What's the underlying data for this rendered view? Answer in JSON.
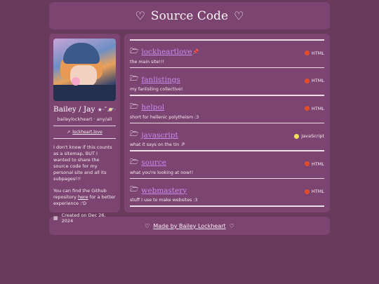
{
  "header": {
    "title": "Source Code",
    "heart_left": "♡",
    "heart_right": "♡"
  },
  "profile": {
    "name": "Bailey / Jay",
    "name_deco": "★‧˚🪐‧",
    "handle": "baileylockheart · any/all",
    "link_text": "lockheart.love",
    "bio_1": "I don't know if this counts as a sitemap, BUT I wanted to share the source code for my personal site and all its subpages!!!",
    "bio_2_before": "You can find the Github repository ",
    "bio_2_link": "here",
    "bio_2_after": " for a better experience :'D",
    "created": "Created on Dec 26, 2024"
  },
  "repos": [
    {
      "name": "lockheartlove",
      "pin": "📌",
      "desc": "the main site!!!",
      "lang": "HTML",
      "lang_color": "#e34c26"
    },
    {
      "name": "fanlistings",
      "pin": "",
      "desc": "my fanlisting collective!",
      "lang": "HTML",
      "lang_color": "#e34c26"
    },
    {
      "name": "helpol",
      "pin": "",
      "desc": "short for hellenic polytheism :3",
      "lang": "HTML",
      "lang_color": "#e34c26"
    },
    {
      "name": "javascript",
      "pin": "",
      "desc": "what it says on the tin :P",
      "lang": "JavaScript",
      "lang_color": "#f1e05a"
    },
    {
      "name": "source",
      "pin": "",
      "desc": "what you're looking at now!!",
      "lang": "HTML",
      "lang_color": "#e34c26"
    },
    {
      "name": "webmastery",
      "pin": "",
      "desc": "stuff I use to make websites :3",
      "lang": "HTML",
      "lang_color": "#e34c26"
    }
  ],
  "footer": {
    "heart_left": "♡",
    "credit": "Made by Bailey Lockheart",
    "heart_right": "♡"
  }
}
